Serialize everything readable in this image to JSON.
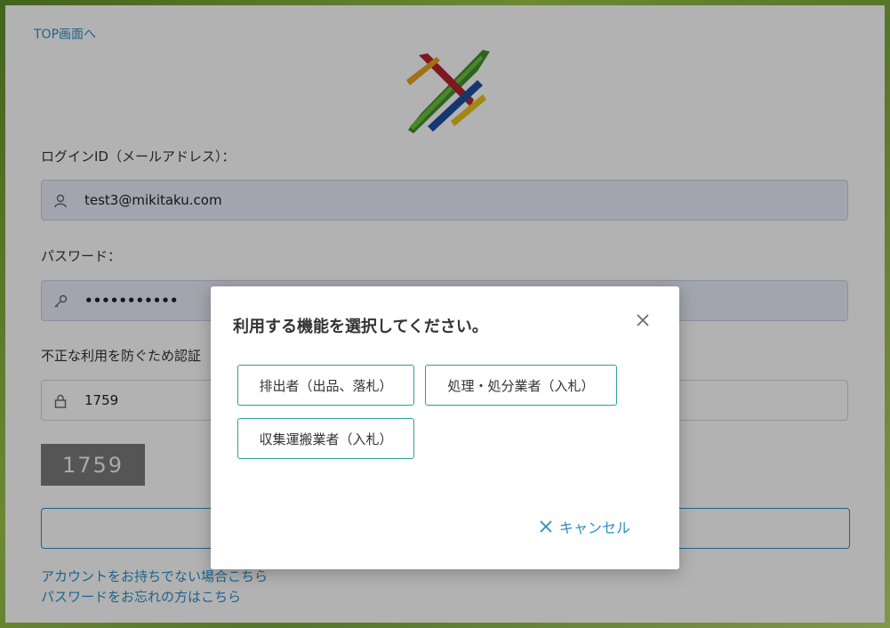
{
  "top_link": "TOP画面へ",
  "login": {
    "id_label": "ログインID（メールアドレス）：",
    "id_value": "test3@mikitaku.com",
    "password_label": "パスワード：",
    "password_value": "•••••••••••",
    "auth_label": "不正な利用を防ぐため認証",
    "auth_value": "1759",
    "captcha_text": "1759"
  },
  "links": {
    "no_account": "アカウントをお持ちでない場合こちら",
    "forgot_password": "パスワードをお忘れの方はこちら"
  },
  "modal": {
    "title": "利用する機能を選択してください。",
    "options": [
      "排出者（出品、落札）",
      "処理・処分業者（入札）",
      "収集運搬業者（入札）"
    ],
    "cancel_label": "キャンセル"
  },
  "icons": {
    "user": "user-icon",
    "key": "key-icon",
    "lock": "lock-icon",
    "close": "close-icon"
  },
  "colors": {
    "link": "#2a8fc7",
    "option_border": "#2aa198"
  }
}
